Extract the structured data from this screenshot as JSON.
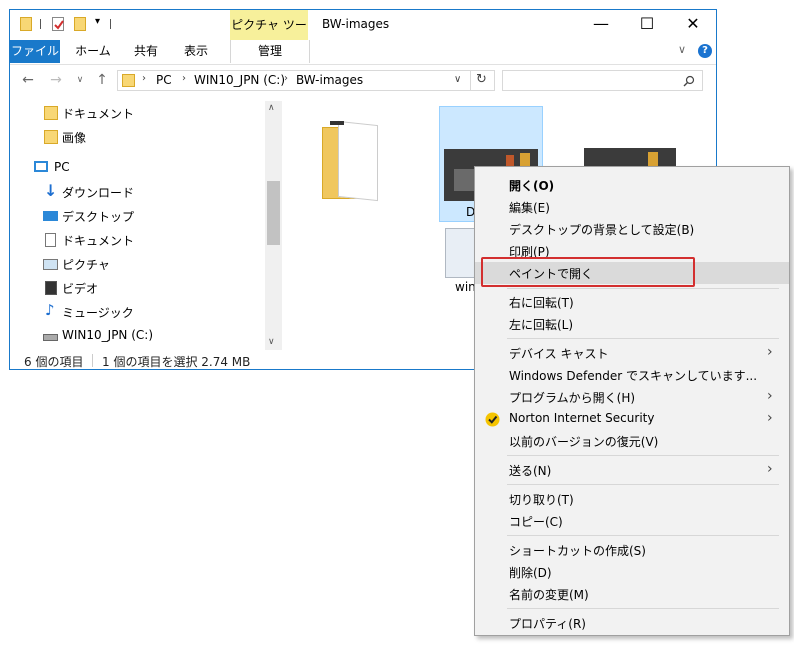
{
  "window": {
    "title": "BW-images",
    "contextual_tab_header": "ピクチャ ツール",
    "controls": {
      "minimize": "—",
      "maximize": "☐",
      "close": "✕"
    }
  },
  "ribbon": {
    "tabs": [
      "ファイル",
      "ホーム",
      "共有",
      "表示",
      "管理"
    ],
    "help": "?",
    "collapse": "∨"
  },
  "address": {
    "crumbs": [
      "PC",
      "WIN10_JPN (C:)",
      "BW-images"
    ],
    "search_placeholder": ""
  },
  "nav": {
    "items": [
      {
        "label": "ドキュメント",
        "icon": "folder-icon"
      },
      {
        "label": "画像",
        "icon": "folder-icon"
      },
      {
        "label": "PC",
        "icon": "pc-icon"
      },
      {
        "label": "ダウンロード",
        "icon": "download-icon"
      },
      {
        "label": "デスクトップ",
        "icon": "desktop-icon"
      },
      {
        "label": "ドキュメント",
        "icon": "document-icon"
      },
      {
        "label": "ピクチャ",
        "icon": "pictures-icon"
      },
      {
        "label": "ビデオ",
        "icon": "video-icon"
      },
      {
        "label": "ミュージック",
        "icon": "music-icon"
      },
      {
        "label": "WIN10_JPN (C:)",
        "icon": "drive-icon"
      }
    ]
  },
  "files": {
    "selected_label_partial": "D",
    "partial_label": "win"
  },
  "status": {
    "count": "6 個の項目",
    "selection": "1 個の項目を選択  2.74 MB"
  },
  "context_menu": {
    "groups": [
      [
        {
          "label": "開く(O)",
          "bold": true
        },
        {
          "label": "編集(E)"
        },
        {
          "label": "デスクトップの背景として設定(B)"
        },
        {
          "label": "印刷(P)"
        },
        {
          "label": "ペイントで開く",
          "highlighted": true
        }
      ],
      [
        {
          "label": "右に回転(T)"
        },
        {
          "label": "左に回転(L)"
        }
      ],
      [
        {
          "label": "デバイス キャスト",
          "submenu": true
        },
        {
          "label": "Windows Defender でスキャンしています..."
        },
        {
          "label": "プログラムから開く(H)",
          "submenu": true
        },
        {
          "label": "Norton Internet Security",
          "submenu": true,
          "icon": "norton-check-icon"
        },
        {
          "label": "以前のバージョンの復元(V)"
        }
      ],
      [
        {
          "label": "送る(N)",
          "submenu": true
        }
      ],
      [
        {
          "label": "切り取り(T)"
        },
        {
          "label": "コピー(C)"
        }
      ],
      [
        {
          "label": "ショートカットの作成(S)"
        },
        {
          "label": "削除(D)"
        },
        {
          "label": "名前の変更(M)"
        }
      ],
      [
        {
          "label": "プロパティ(R)"
        }
      ]
    ]
  },
  "colors": {
    "accent": "#1979ca",
    "contextual_tab": "#f7f09b",
    "selection": "#cce8ff",
    "highlight_box": "#d32f2f",
    "norton": "#f5c400"
  }
}
